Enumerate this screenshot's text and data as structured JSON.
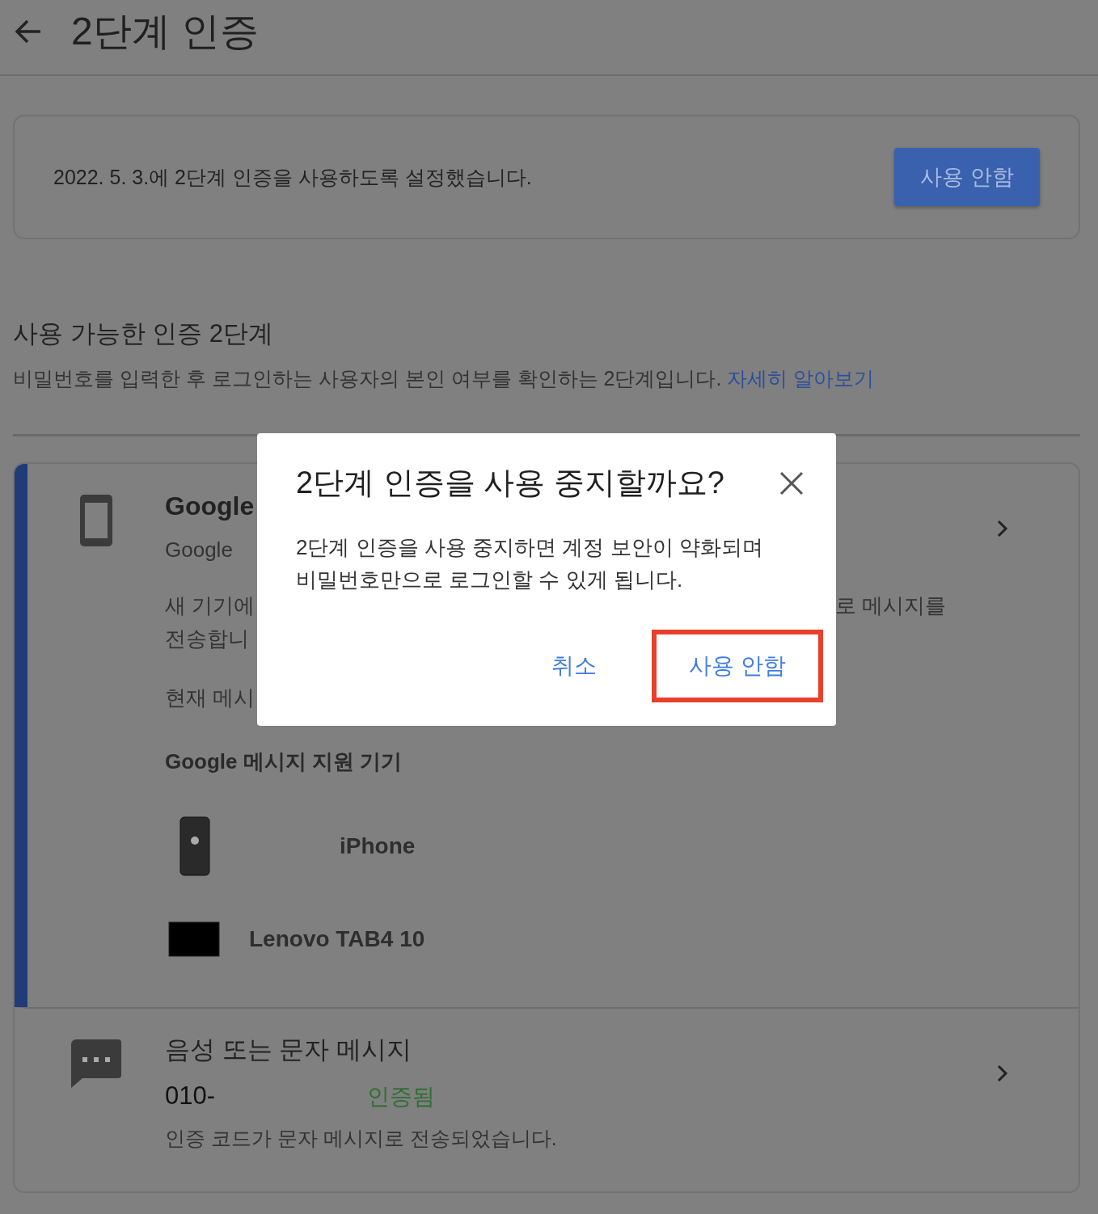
{
  "header": {
    "title": "2단계 인증"
  },
  "status_card": {
    "text": "2022. 5. 3.에 2단계 인증을 사용하도록 설정했습니다.",
    "button": "사용 안함"
  },
  "section": {
    "title": "사용 가능한 인증 2단계",
    "description": "비밀번호를 입력한 후 로그인하는 사용자의 본인 여부를 확인하는 2단계입니다.",
    "link": "자세히 알아보기"
  },
  "methods": [
    {
      "kind": "prompt",
      "selected": true,
      "title": "Google",
      "subtitle": "Google",
      "line_1_left": "새 기기에",
      "line_1_right": "로 메시지를",
      "line_2": "전송합니",
      "current": "현재 메시",
      "devices_title": "Google 메시지 지원 기기",
      "devices": [
        {
          "kind": "phone",
          "name": "iPhone"
        },
        {
          "kind": "tablet",
          "name": "Lenovo TAB4 10"
        }
      ]
    },
    {
      "kind": "sms",
      "selected": false,
      "title": "음성 또는 문자 메시지",
      "number": "010-",
      "status": "인증됨",
      "description": "인증 코드가 문자 메시지로 전송되었습니다."
    }
  ],
  "dialog": {
    "title": "2단계 인증을 사용 중지할까요?",
    "body": "2단계 인증을 사용 중지하면 계정 보안이 약화되며\n비밀번호만으로 로그인할 수 있게 됩니다.",
    "buttons": [
      {
        "label": "취소",
        "highlighted": false
      },
      {
        "label": "사용 안함",
        "highlighted": true
      }
    ]
  }
}
